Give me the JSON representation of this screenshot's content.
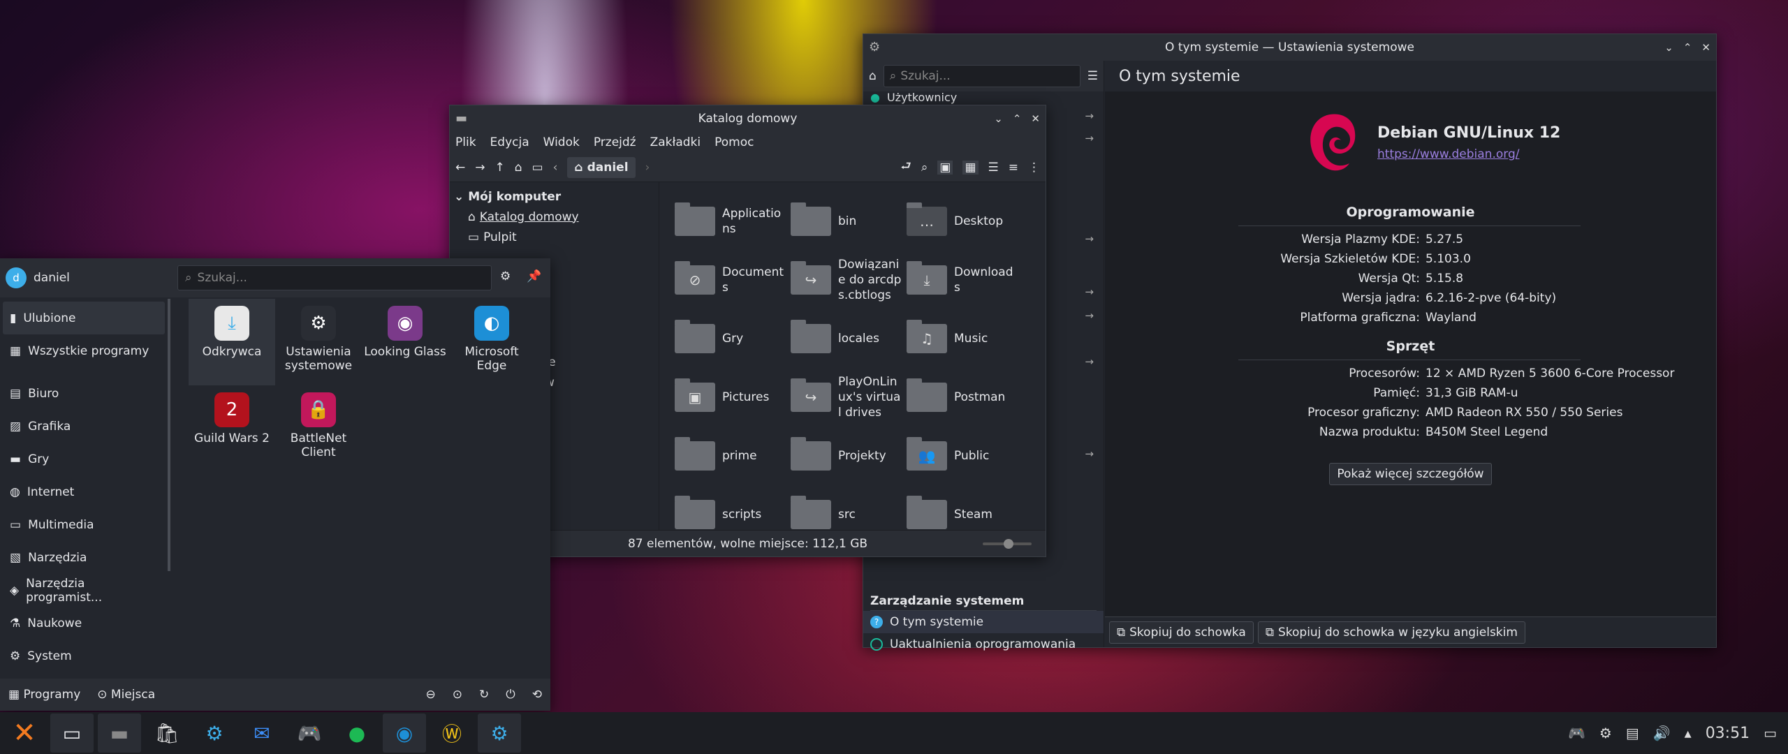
{
  "sysinfo": {
    "title": "O tym systemie — Ustawienia systemowe",
    "search_placeholder": "Szukaj...",
    "page_title": "O tym systemie",
    "sidebar_top_item": "Użytkownicy",
    "sidebar_section": "Zarządzanie systemem",
    "sidebar_items": [
      "O tym systemie",
      "Uaktualnienia oprogramowania"
    ],
    "os_name": "Debian GNU/Linux 12",
    "os_url": "https://www.debian.org/",
    "software_heading": "Oprogramowanie",
    "software": [
      {
        "k": "Wersja Plazmy KDE:",
        "v": "5.27.5"
      },
      {
        "k": "Wersja Szkieletów KDE:",
        "v": "5.103.0"
      },
      {
        "k": "Wersja Qt:",
        "v": "5.15.8"
      },
      {
        "k": "Wersja jądra:",
        "v": "6.2.16-2-pve (64-bity)"
      },
      {
        "k": "Platforma graficzna:",
        "v": "Wayland"
      }
    ],
    "hardware_heading": "Sprzęt",
    "hardware": [
      {
        "k": "Procesorów:",
        "v": "12 × AMD Ryzen 5 3600 6-Core Processor"
      },
      {
        "k": "Pamięć:",
        "v": "31,3 GiB RAM-u"
      },
      {
        "k": "Procesor graficzny:",
        "v": "AMD Radeon RX 550 / 550 Series"
      },
      {
        "k": "Nazwa produktu:",
        "v": "B450M Steel Legend"
      }
    ],
    "more_button": "Pokaż więcej szczegółów",
    "copy_button": "Skopiuj do schowka",
    "copy_en_button": "Skopiuj do schowka w języku angielskim"
  },
  "dolphin": {
    "title": "Katalog domowy",
    "menu": [
      "Plik",
      "Edycja",
      "Widok",
      "Przejdź",
      "Zakładki",
      "Pomoc"
    ],
    "crumb": "daniel",
    "tree_root": "Mój komputer",
    "tree_items": [
      "Katalog domowy",
      "Pulpit"
    ],
    "tree_partial": [
      "wane",
      "w"
    ],
    "files": [
      {
        "name": "Applications",
        "badge": ""
      },
      {
        "name": "bin",
        "badge": ""
      },
      {
        "name": "Desktop",
        "badge": "…"
      },
      {
        "name": "Documents",
        "badge": "⊘"
      },
      {
        "name": "Dowiązanie do arcdps.cbtlogs",
        "badge": "↪"
      },
      {
        "name": "Downloads",
        "badge": "⤓"
      },
      {
        "name": "Gry",
        "badge": ""
      },
      {
        "name": "locales",
        "badge": ""
      },
      {
        "name": "Music",
        "badge": "♫"
      },
      {
        "name": "Pictures",
        "badge": "▣"
      },
      {
        "name": "PlayOnLinux's virtual drives",
        "badge": "↪"
      },
      {
        "name": "Postman",
        "badge": ""
      },
      {
        "name": "prime",
        "badge": ""
      },
      {
        "name": "Projekty",
        "badge": ""
      },
      {
        "name": "Public",
        "badge": "👥"
      },
      {
        "name": "scripts",
        "badge": ""
      },
      {
        "name": "src",
        "badge": ""
      },
      {
        "name": "Steam",
        "badge": ""
      }
    ],
    "status": "87 elementów, wolne miejsce: 112,1 GB"
  },
  "launcher": {
    "user": "daniel",
    "avatar_letter": "d",
    "search_placeholder": "Szukaj...",
    "categories": [
      "Ulubione",
      "Wszystkie programy",
      "Biuro",
      "Grafika",
      "Gry",
      "Internet",
      "Multimedia",
      "Narzędzia",
      "Narzędzia programist...",
      "Naukowe",
      "System"
    ],
    "apps": [
      {
        "name": "Odkrywca",
        "color": "#e8e8e8"
      },
      {
        "name": "Ustawienia systemowe",
        "color": "#2a2d34"
      },
      {
        "name": "Looking Glass",
        "color": "#7b3a8a"
      },
      {
        "name": "Microsoft Edge",
        "color": "#1d8fd6"
      },
      {
        "name": "Guild Wars 2",
        "color": "#b3121d"
      },
      {
        "name": "BattleNet Client",
        "color": "#c2185b"
      }
    ],
    "footer_tabs": [
      "Programy",
      "Miejsca"
    ]
  },
  "taskbar": {
    "clock": "03:51"
  }
}
